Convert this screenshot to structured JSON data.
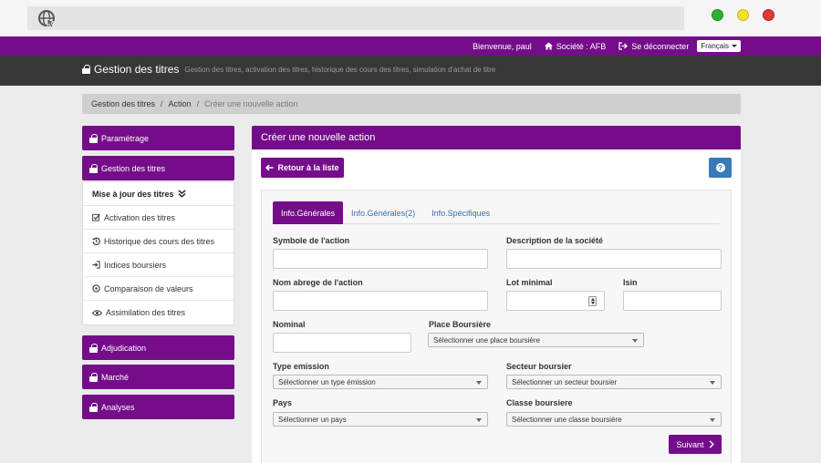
{
  "colors": {
    "primary": "#750d8a",
    "dark": "#373737",
    "info": "#3979b6",
    "red": "#e03a3a",
    "yellow": "#f2e02a",
    "green": "#2fb02f"
  },
  "browser": {
    "logo_icon": "globe-cursor-icon"
  },
  "topbar": {
    "welcome": "Bienvenue, paul",
    "company": "Société : AFB",
    "logout": "Se déconnecter",
    "language": "Français"
  },
  "header": {
    "title": "Gestion des titres",
    "subtitle": "Gestion des titres, activation des titres, historique des cours des titres, simulation d'achat de titre"
  },
  "breadcrumb": {
    "items": [
      "Gestion des titres",
      "Action"
    ],
    "current": "Créer une nouvelle action"
  },
  "sidebar": {
    "parametrage": "Paramétrage",
    "gestion": "Gestion des titres",
    "sub": {
      "miseajour": "Mise à jour des titres",
      "activation": "Activation des titres",
      "historique": "Historique des cours des titres",
      "indices": "Indices boursiers",
      "comparaison": "Comparaison de valeurs",
      "assimilation": "Assimilation des titres"
    },
    "adjudication": "Adjudication",
    "marche": "Marché",
    "analyses": "Analyses"
  },
  "panel": {
    "title": "Créer une nouvelle action",
    "back": "Retour à la liste",
    "help": "?"
  },
  "tabs": [
    "Info.Générales",
    "Info.Générales(2)",
    "Info.Spécifiques"
  ],
  "form": {
    "symbole": "Symbole de l'action",
    "description": "Description de la société",
    "nom": "Nom abrege de l'action",
    "lot": "Lot minimal",
    "isin": "Isin",
    "nominal": "Nominal",
    "place": "Place Boursière",
    "place_sel": "Sélectionner une place boursière",
    "type": "Type emission",
    "type_sel": "Sélectionner un type émission",
    "secteur": "Secteur boursier",
    "secteur_sel": "Sélectionner un secteur boursier",
    "pays": "Pays",
    "pays_sel": "Sélectionner un pays",
    "classe": "Classe boursiere",
    "classe_sel": "Sélectionner une classe boursière"
  },
  "next": "Suivant"
}
